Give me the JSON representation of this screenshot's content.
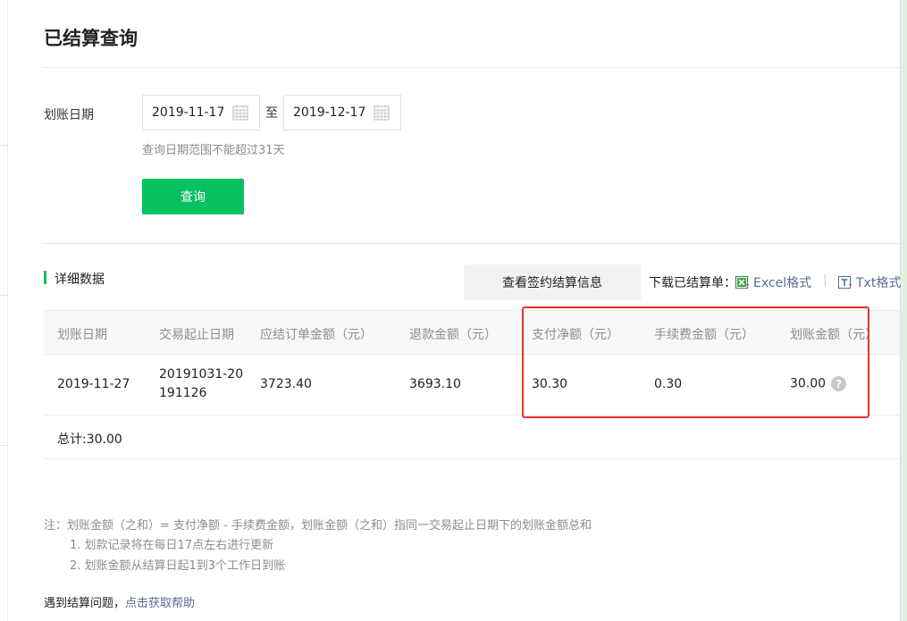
{
  "page": {
    "title": "已结算查询"
  },
  "filter": {
    "date_label": "划账日期",
    "start_date": "2019-11-17",
    "end_date": "2019-12-17",
    "separator": "至",
    "hint": "查询日期范围不能超过31天",
    "query_button": "查询"
  },
  "details": {
    "section_title": "详细数据",
    "sign_info_button": "查看签约结算信息",
    "download_label": "下载已结算单：",
    "excel_link": "Excel格式",
    "txt_link": "Txt格式",
    "download_separator": "|"
  },
  "table": {
    "columns": [
      "划账日期",
      "交易起止日期",
      "应结订单金额（元）",
      "退款金额（元）",
      "支付净额（元）",
      "手续费金额（元）",
      "划账金额（元）"
    ],
    "rows": [
      {
        "date": "2019-11-27",
        "range_line1": "20191031-20",
        "range_line2": "191126",
        "order_amount": "3723.40",
        "refund_amount": "3693.10",
        "net_amount": "30.30",
        "fee_amount": "0.30",
        "transfer_amount": "30.00"
      }
    ],
    "total": "总计:30.00"
  },
  "notes": {
    "line1": "注：划账金额（之和）= 支付净额 - 手续费金额，划账金额（之和）指同一交易起止日期下的划账金额总和",
    "line2": "1. 划款记录将在每日17点左右进行更新",
    "line3": "2. 划账金额从结算日起1到3个工作日到账"
  },
  "help": {
    "prefix": "遇到结算问题，",
    "link": "点击获取帮助"
  },
  "icons": {
    "calendar": "calendar-icon",
    "excel": "excel-icon",
    "txt": "txt-icon",
    "help": "question-icon",
    "help_glyph": "?"
  },
  "colors": {
    "accent": "#07c160",
    "link": "#576b95",
    "highlight": "#e8302a"
  }
}
